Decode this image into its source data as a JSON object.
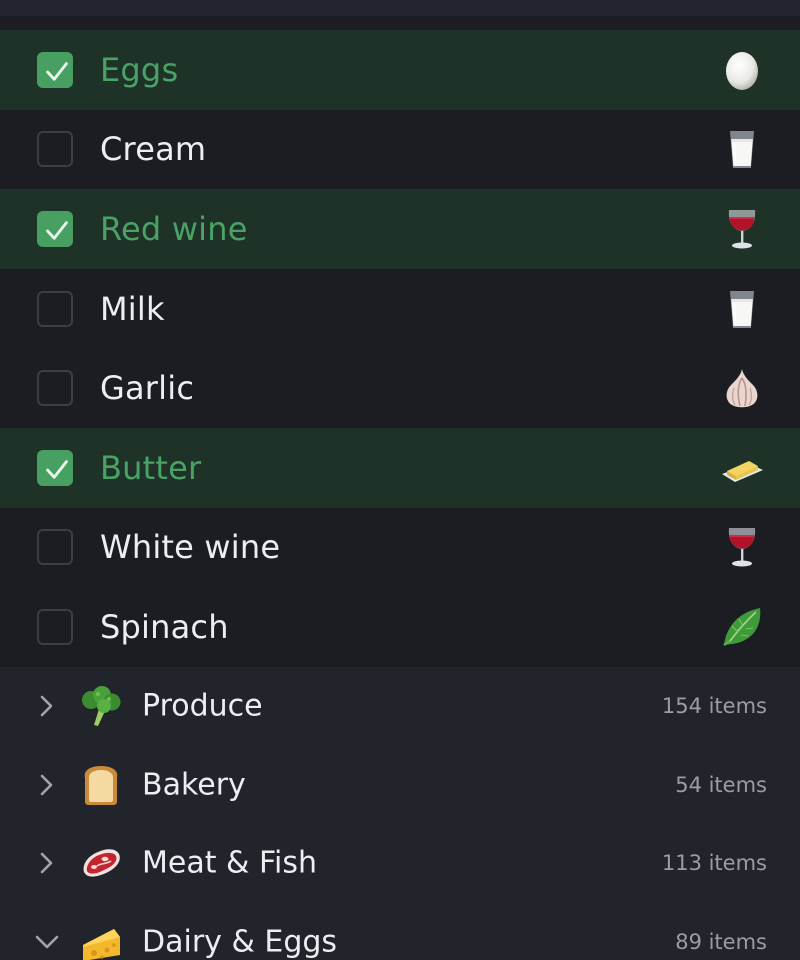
{
  "colors": {
    "background": "#1c1d23",
    "checked_row_background": "#1e3228",
    "checked_accent": "#47a061",
    "checked_text": "#4aa265",
    "text": "#eceef2",
    "muted_text": "#9a9ca6",
    "category_background": "#22242c"
  },
  "items": [
    {
      "label": "Eggs",
      "checked": true,
      "icon": "egg-icon"
    },
    {
      "label": "Cream",
      "checked": false,
      "icon": "glass-of-milk-icon"
    },
    {
      "label": "Red wine",
      "checked": true,
      "icon": "wine-glass-icon"
    },
    {
      "label": "Milk",
      "checked": false,
      "icon": "glass-of-milk-icon"
    },
    {
      "label": "Garlic",
      "checked": false,
      "icon": "garlic-icon"
    },
    {
      "label": "Butter",
      "checked": true,
      "icon": "butter-icon"
    },
    {
      "label": "White wine",
      "checked": false,
      "icon": "wine-glass-icon"
    },
    {
      "label": "Spinach",
      "checked": false,
      "icon": "leafy-green-icon"
    }
  ],
  "categories": [
    {
      "label": "Produce",
      "count": "154 items",
      "icon": "broccoli-icon",
      "expanded": false
    },
    {
      "label": "Bakery",
      "count": "54 items",
      "icon": "bread-icon",
      "expanded": false
    },
    {
      "label": "Meat & Fish",
      "count": "113 items",
      "icon": "steak-icon",
      "expanded": false
    },
    {
      "label": "Dairy & Eggs",
      "count": "89 items",
      "icon": "cheese-icon",
      "expanded": true
    }
  ]
}
